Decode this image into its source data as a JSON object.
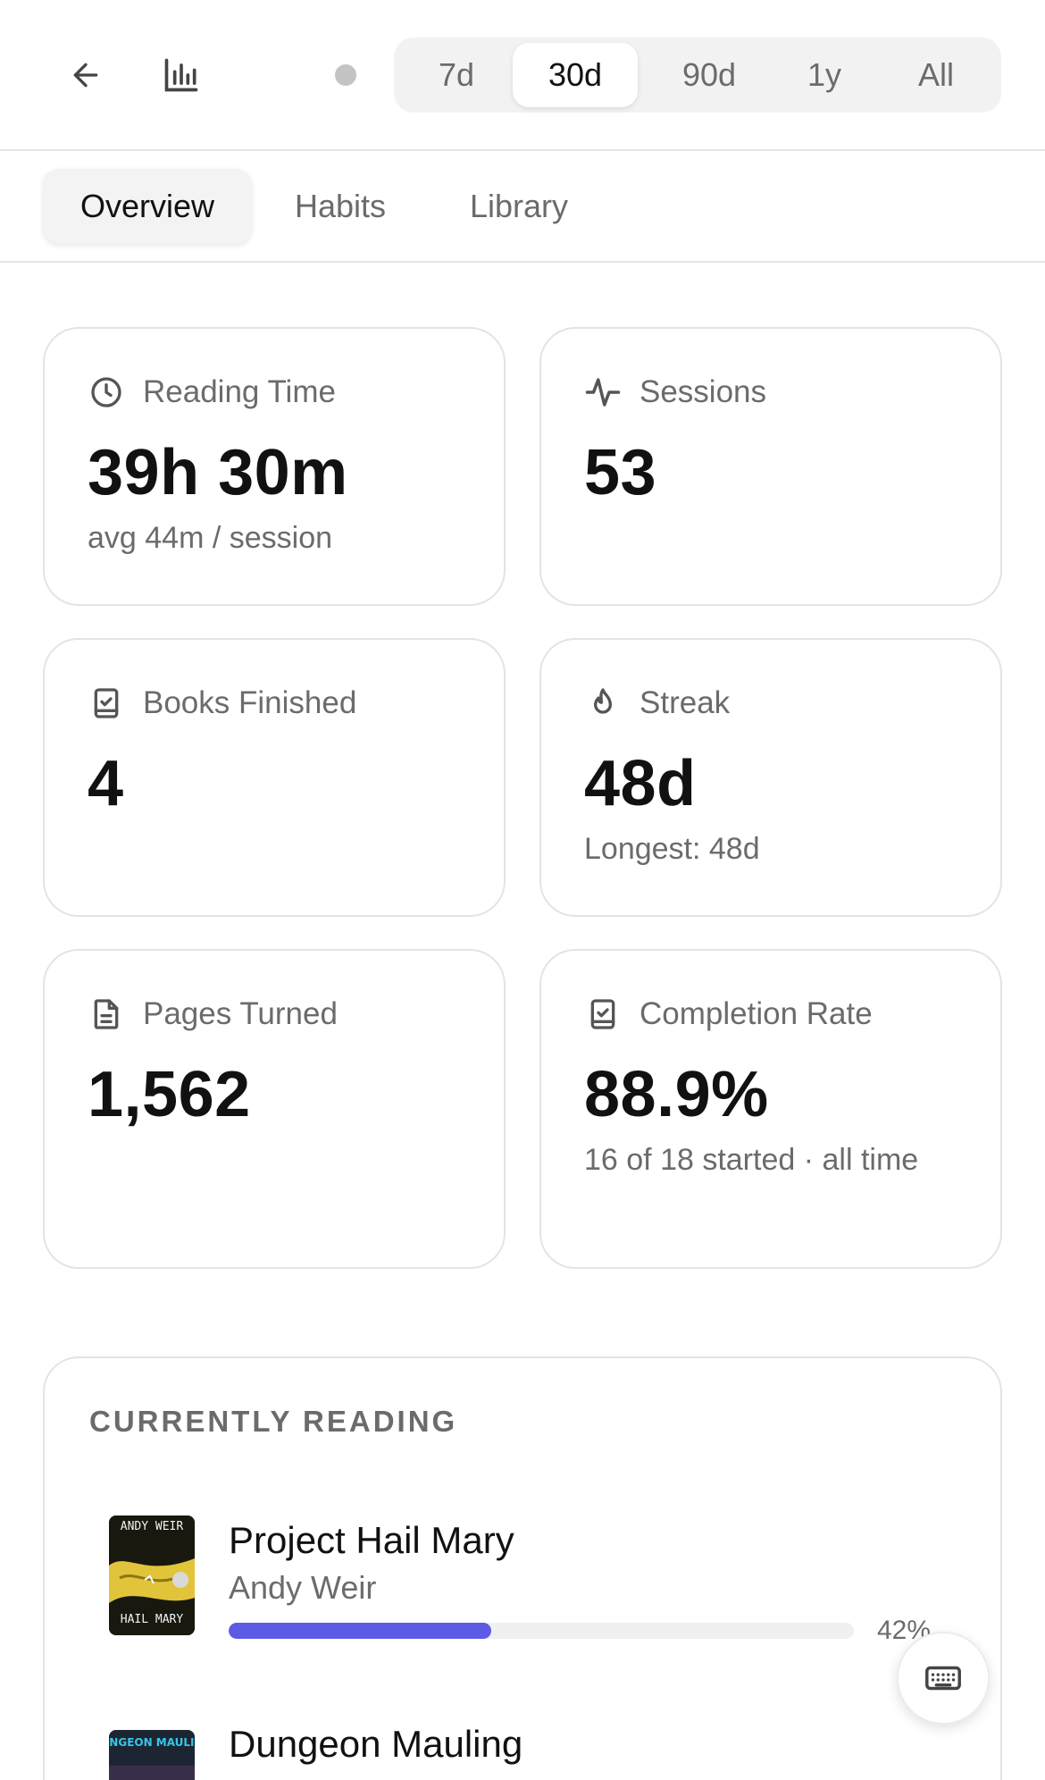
{
  "header": {
    "back_icon": "arrow-left-icon",
    "stats_icon": "bar-chart-icon",
    "range_options": [
      "7d",
      "30d",
      "90d",
      "1y",
      "All"
    ],
    "range_selected": "30d"
  },
  "tabs": [
    "Overview",
    "Habits",
    "Library"
  ],
  "tab_selected": "Overview",
  "stats": {
    "reading_time": {
      "label": "Reading Time",
      "value": "39h 30m",
      "sub": "avg 44m / session",
      "icon": "clock-icon"
    },
    "sessions": {
      "label": "Sessions",
      "value": "53",
      "icon": "activity-icon"
    },
    "books_finished": {
      "label": "Books Finished",
      "value": "4",
      "icon": "book-check-icon"
    },
    "streak": {
      "label": "Streak",
      "value": "48d",
      "sub": "Longest: 48d",
      "icon": "flame-icon"
    },
    "pages_turned": {
      "label": "Pages Turned",
      "value": "1,562",
      "icon": "file-text-icon"
    },
    "completion_rate": {
      "label": "Completion Rate",
      "value": "88.9%",
      "sub": "16 of 18 started · all time",
      "icon": "book-check-icon"
    }
  },
  "currently_reading": {
    "title": "CURRENTLY READING",
    "books": [
      {
        "title": "Project Hail Mary",
        "author": "Andy Weir",
        "progress": 0.42,
        "progress_label": "42%",
        "cover_text_top": "ANDY WEIR",
        "cover_text_bottom": "HAIL MARY"
      },
      {
        "title": "Dungeon Mauling",
        "author": "",
        "cover_text_top": "DUNGEON MAULING"
      }
    ]
  },
  "colors": {
    "accent": "#5b5be6",
    "muted_text": "#6b6b6b",
    "border": "#e3e3e3"
  },
  "fab": {
    "icon": "keyboard-icon"
  }
}
